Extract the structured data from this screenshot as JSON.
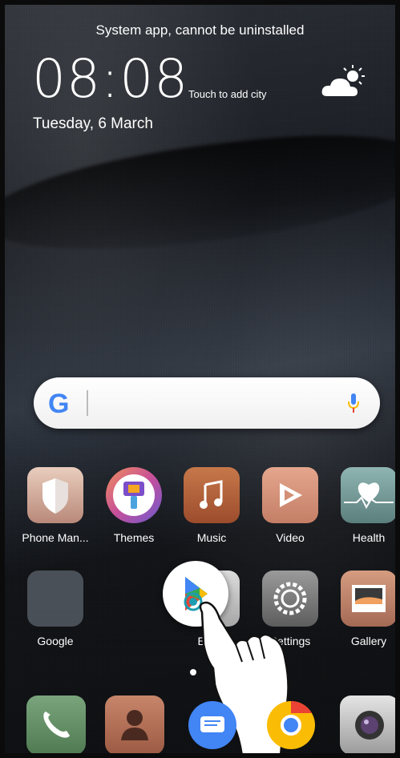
{
  "status": {
    "message": "System app, cannot be uninstalled"
  },
  "lockscreen": {
    "time": "08:08",
    "date": "Tuesday, 6 March",
    "weather_prompt": "Touch to add city"
  },
  "search_bar": {
    "logo": "G"
  },
  "apps_row1": [
    {
      "label": "Phone Man..."
    },
    {
      "label": "Themes"
    },
    {
      "label": "Music"
    },
    {
      "label": "Video"
    },
    {
      "label": "Health"
    }
  ],
  "apps_row2": [
    {
      "label": "Google"
    },
    {
      "label": "Email"
    },
    {
      "label": "Settings"
    },
    {
      "label": "Gallery"
    }
  ],
  "dock": [
    {
      "icon": "phone-icon"
    },
    {
      "icon": "contacts-icon"
    },
    {
      "icon": "messages-icon"
    },
    {
      "icon": "chrome-icon"
    },
    {
      "icon": "camera-icon"
    }
  ],
  "colors": {
    "google_blue": "#4285F4",
    "google_red": "#EA4335",
    "google_yellow": "#FBBC05",
    "google_green": "#34A853"
  }
}
